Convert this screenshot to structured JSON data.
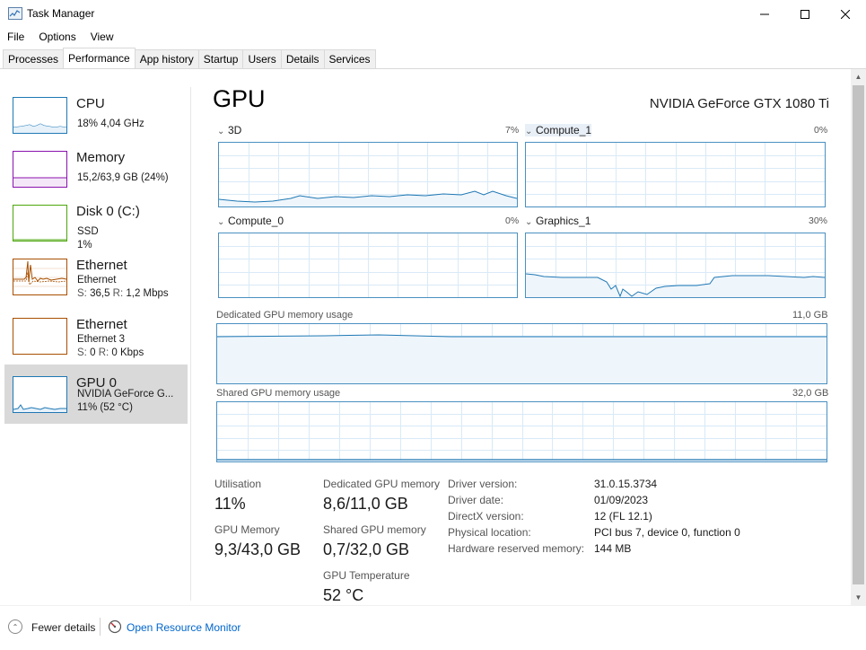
{
  "window": {
    "title": "Task Manager",
    "icon": "task-manager-icon"
  },
  "menu": [
    "File",
    "Options",
    "View"
  ],
  "tabs": [
    "Processes",
    "Performance",
    "App history",
    "Startup",
    "Users",
    "Details",
    "Services"
  ],
  "active_tab": "Performance",
  "sidebar": {
    "items": [
      {
        "title": "CPU",
        "line1": "18% 4,04 GHz",
        "line2": "",
        "color": "#1f78b4"
      },
      {
        "title": "Memory",
        "line1": "15,2/63,9 GB (24%)",
        "line2": "",
        "color": "#8b12ae"
      },
      {
        "title": "Disk 0 (C:)",
        "line1": "SSD",
        "line2": "1%",
        "color": "#4da60c"
      },
      {
        "title": "Ethernet",
        "line1": "Ethernet",
        "line2_s_label": "S:",
        "line2_s": "36,5",
        "line2_r_label": "R:",
        "line2_r": "1,2 Mbps",
        "color": "#a74f01"
      },
      {
        "title": "Ethernet",
        "line1": "Ethernet 3",
        "line2_s_label": "S:",
        "line2_s": "0",
        "line2_r_label": "R:",
        "line2_r": "0 Kbps",
        "color": "#a74f01"
      },
      {
        "title": "GPU 0",
        "line1": "NVIDIA GeForce G...",
        "line2": "11% (52 °C)",
        "color": "#1f78b4"
      }
    ]
  },
  "main": {
    "title": "GPU",
    "device_name": "NVIDIA GeForce GTX 1080 Ti",
    "engines": [
      {
        "label": "3D",
        "percent": "7%"
      },
      {
        "label": "Compute_1",
        "percent": "0%"
      },
      {
        "label": "Compute_0",
        "percent": "0%"
      },
      {
        "label": "Graphics_1",
        "percent": "30%"
      }
    ],
    "dedicated_label": "Dedicated GPU memory usage",
    "dedicated_max": "11,0 GB",
    "shared_label": "Shared GPU memory usage",
    "shared_max": "32,0 GB",
    "stats": {
      "utilisation_label": "Utilisation",
      "utilisation": "11%",
      "dedicated_label": "Dedicated GPU memory",
      "dedicated": "8,6/11,0 GB",
      "gpu_memory_label": "GPU Memory",
      "gpu_memory": "9,3/43,0 GB",
      "shared_label": "Shared GPU memory",
      "shared": "0,7/32,0 GB",
      "temperature_label": "GPU Temperature",
      "temperature": "52 °C"
    },
    "info": [
      {
        "key": "Driver version:",
        "value": "31.0.15.3734"
      },
      {
        "key": "Driver date:",
        "value": "01/09/2023"
      },
      {
        "key": "DirectX version:",
        "value": "12 (FL 12.1)"
      },
      {
        "key": "Physical location:",
        "value": "PCI bus 7, device 0, function 0"
      },
      {
        "key": "Hardware reserved memory:",
        "value": "144 MB"
      }
    ]
  },
  "footer": {
    "fewer_details": "Fewer details",
    "open_resource_monitor": "Open Resource Monitor"
  },
  "colors": {
    "accent": "#1f78b4",
    "graph_border": "#4a90c0",
    "graph_grid": "#d9eaf7",
    "link": "#0066cc"
  }
}
